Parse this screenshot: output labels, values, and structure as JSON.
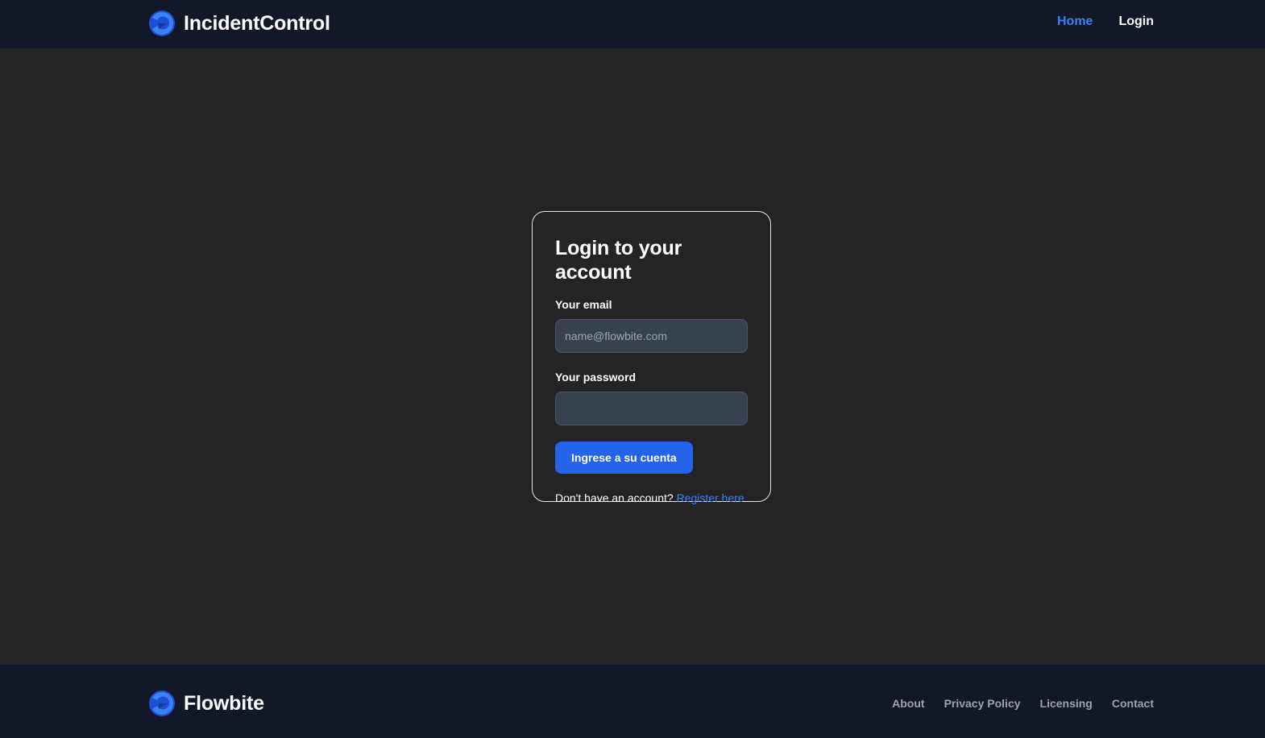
{
  "header": {
    "brand_name": "IncidentControl",
    "logo_icon": "flowbite-logo-icon",
    "nav": [
      {
        "label": "Home",
        "active": true
      },
      {
        "label": "Login",
        "active": false
      }
    ]
  },
  "login": {
    "title": "Login to your account",
    "email_label": "Your email",
    "email_placeholder": "name@flowbite.com",
    "email_value": "",
    "password_label": "Your password",
    "password_value": "",
    "submit_label": "Ingrese a su cuenta",
    "register_prompt": "Don't have an account?",
    "register_link": "Register here"
  },
  "footer": {
    "brand_name": "Flowbite",
    "logo_icon": "flowbite-logo-icon",
    "links": [
      "About",
      "Privacy Policy",
      "Licensing",
      "Contact"
    ]
  },
  "colors": {
    "background": "#242424",
    "navbar": "#111827",
    "accent": "#3b82f6",
    "button": "#2563eb",
    "input_bg": "#374151"
  }
}
